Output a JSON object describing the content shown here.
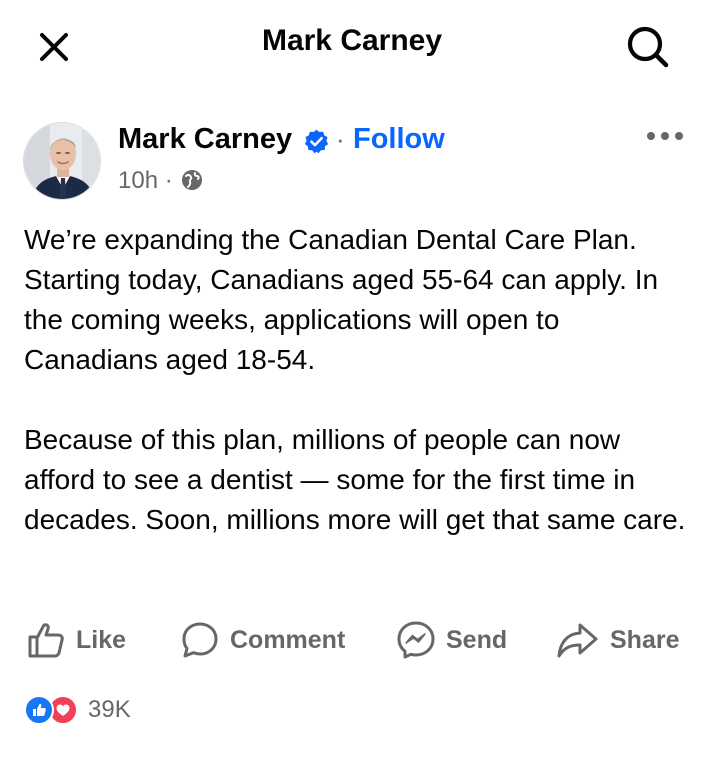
{
  "header": {
    "title": "Mark Carney",
    "close_icon": "close-icon",
    "search_icon": "search-icon"
  },
  "post": {
    "author": "Mark Carney",
    "verified_icon": "verified-badge-icon",
    "separator": "·",
    "follow_label": "Follow",
    "time": "10h ·",
    "privacy_icon": "globe-icon",
    "more_icon": "more-icon",
    "paragraphs": [
      "We’re expanding the Canadian Dental Care Plan. Starting today, Canadians aged 55-64 can apply. In the coming weeks, applications will open to Canadians aged 18-54.",
      "Because of this plan, millions of people can now afford to see a dentist — some for the first time in decades. Soon, millions more will get that same care."
    ]
  },
  "actions": {
    "like": "Like",
    "comment": "Comment",
    "send": "Send",
    "share": "Share"
  },
  "reactions": {
    "types": [
      "like",
      "love"
    ],
    "count": "39K"
  },
  "colors": {
    "link_blue": "#0866ff",
    "secondary_text": "#65676b",
    "like_blue": "#1877f2",
    "love_red": "#f33e58"
  }
}
